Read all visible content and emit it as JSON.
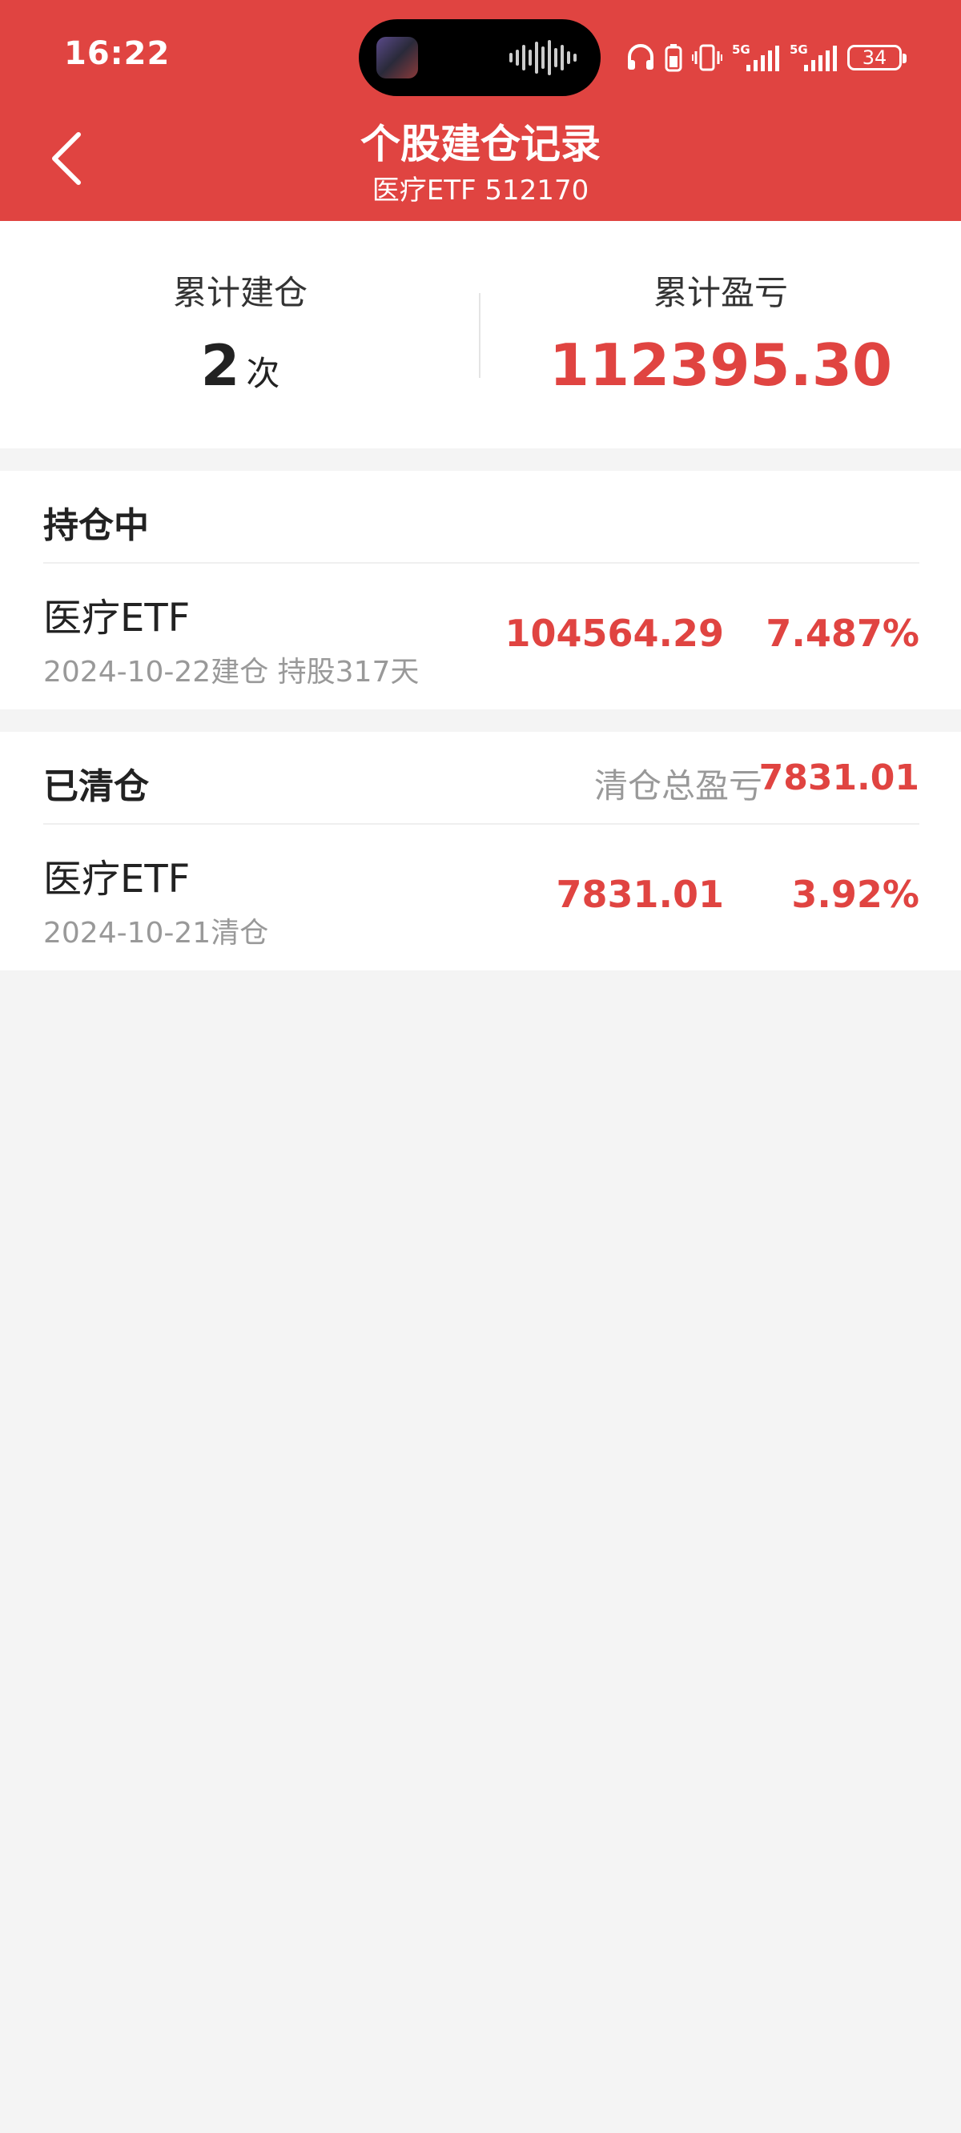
{
  "status_bar": {
    "time": "16:22",
    "battery": "34",
    "network_1": "5G",
    "network_2": "5G"
  },
  "header": {
    "back_icon": "chevron-left-icon",
    "title": "个股建仓记录",
    "subtitle": "医疗ETF 512170"
  },
  "summary": {
    "count_label": "累计建仓",
    "count_value": "2",
    "count_unit": "次",
    "pnl_label": "累计盈亏",
    "pnl_value": "112395.30"
  },
  "holding": {
    "title": "持仓中",
    "rows": [
      {
        "name": "医疗ETF",
        "sub": "2024-10-22建仓 持股317天",
        "amount": "104564.29",
        "percent": "7.487%"
      }
    ]
  },
  "closed": {
    "title": "已清仓",
    "total_label": "清仓总盈亏",
    "total_value": "7831.01",
    "rows": [
      {
        "name": "医疗ETF",
        "sub": "2024-10-21清仓",
        "amount": "7831.01",
        "percent": "3.92%"
      }
    ]
  },
  "colors": {
    "accent": "#e04441",
    "background": "#f4f4f4",
    "muted": "#999999"
  }
}
